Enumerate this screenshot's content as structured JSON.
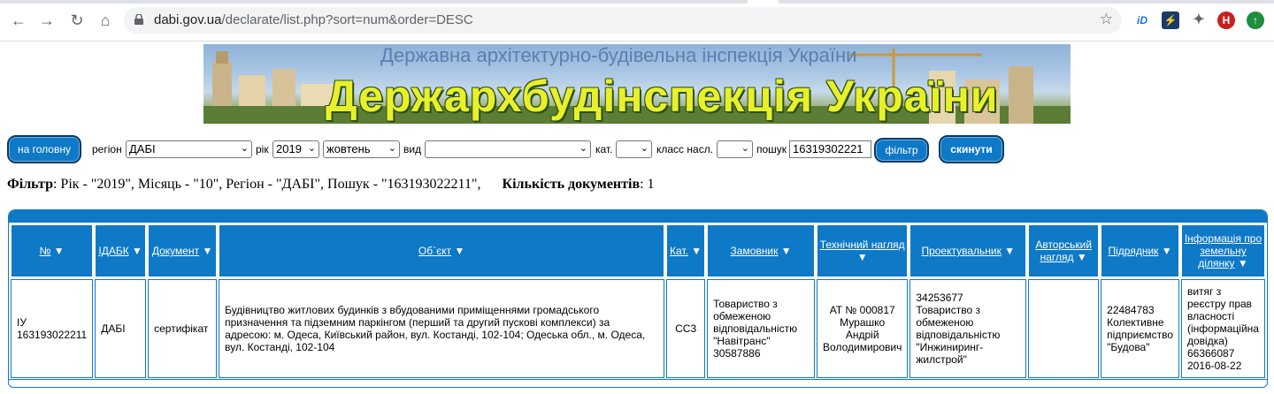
{
  "browser": {
    "url_host": "dabi.gov.ua",
    "url_path": "/declarate/list.php?sort=num&order=DESC",
    "ext_avatar_letter": "H"
  },
  "banner": {
    "subtitle": "Державна архітектурно-будівельна інспекція України",
    "title": "Держархбудінспекція України"
  },
  "controls": {
    "home_button": "на головну",
    "region_label": "регіон",
    "region_value": "ДАБІ",
    "year_label": "рік",
    "year_value": "2019",
    "month_value": "жовтень",
    "type_label": "вид",
    "type_value": "",
    "cat_label": "кат.",
    "cat_value": "",
    "class_label": "класс насл.",
    "class_value": "",
    "search_label": "пошук",
    "search_value": "16319302221",
    "filter_button": "фільтр",
    "reset_button": "скинути"
  },
  "filter_summary": {
    "filter_label": "Фільтр",
    "filter_text": ": Рік - \"2019\", Місяць - \"10\", Регіон - \"ДАБІ\", Пошук - \"163193022211\",",
    "count_label": "Кількість документів",
    "count_text": ": 1"
  },
  "table": {
    "headers": [
      "№",
      "ІДАБК",
      "Документ",
      "Об`єкт",
      "Кат.",
      "Замовник",
      "Технічний нагляд",
      "Проектувальник",
      "Авторський нагляд",
      "Підрядник",
      "Інформація про земельну ділянку"
    ],
    "rows": [
      [
        "ІУ 163193022211",
        "ДАБІ",
        "сертифікат",
        "Будівництво житлових будинків з вбудованими приміщеннями громадського призначення та підземним паркінгом (перший та другий пускові комплекси) за адресою: м. Одеса, Київський район, вул. Костанді, 102-104; Одеська обл., м. Одеса, вул. Костанді, 102-104",
        "СС3",
        "Товариство з обмеженою відповідальністю \"Навітранс\" 30587886",
        "АТ № 000817 Мурашко Андрій Володимирович",
        "34253677 Товариство з обмеженою відповідальністю \"Инжиниринг-жилстрой\"",
        "",
        "22484783 Колективне підприємство \"Будова\"",
        "витяг з реєстру прав власності (інформаційна довідка) 66366087 2016-08-22"
      ]
    ]
  }
}
